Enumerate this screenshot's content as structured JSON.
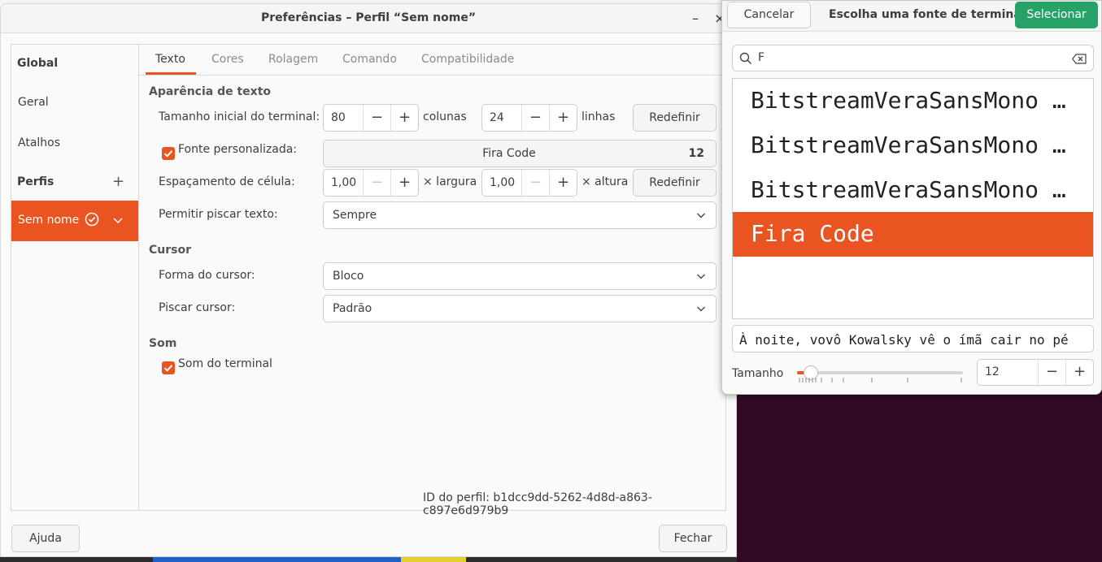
{
  "window": {
    "title": "Preferências – Perfil “Sem nome”",
    "minimize_icon": "–",
    "close_icon": "×"
  },
  "sidebar": {
    "global_header": "Global",
    "items": [
      {
        "label": "Geral"
      },
      {
        "label": "Atalhos"
      }
    ],
    "profiles_header": "Perfis",
    "add_profile_icon": "+",
    "profile": {
      "name": "Sem nome",
      "is_default": true
    }
  },
  "tabs": [
    {
      "label": "Texto",
      "active": true
    },
    {
      "label": "Cores",
      "active": false
    },
    {
      "label": "Rolagem",
      "active": false
    },
    {
      "label": "Comando",
      "active": false
    },
    {
      "label": "Compatibilidade",
      "active": false
    }
  ],
  "text_appearance": {
    "header": "Aparência de texto",
    "initial_size_label": "Tamanho inicial do terminal:",
    "columns_value": "80",
    "columns_unit": "colunas",
    "rows_value": "24",
    "rows_unit": "linhas",
    "reset_label": "Redefinir",
    "custom_font_label": "Fonte personalizada:",
    "custom_font_checked": true,
    "font_name": "Fira Code",
    "font_size": "12",
    "cell_spacing_label": "Espaçamento de célula:",
    "width_value": "1,00",
    "width_unit": "× largura",
    "height_value": "1,00",
    "height_unit": "× altura",
    "reset_label_2": "Redefinir",
    "blink_text_label": "Permitir piscar texto:",
    "blink_text_value": "Sempre",
    "minus": "−",
    "plus": "+"
  },
  "cursor": {
    "header": "Cursor",
    "shape_label": "Forma do cursor:",
    "shape_value": "Bloco",
    "blink_label": "Piscar cursor:",
    "blink_value": "Padrão"
  },
  "sound": {
    "header": "Som",
    "terminal_bell_label": "Som do terminal",
    "terminal_bell_checked": true
  },
  "profile_id": {
    "label": "ID do perfil:",
    "value": "b1dcc9dd-5262-4d8d-a863-c897e6d979b9"
  },
  "footer": {
    "help_label": "Ajuda",
    "close_label": "Fechar"
  },
  "font_dialog": {
    "cancel_label": "Cancelar",
    "title": "Escolha uma fonte de terminal",
    "select_label": "Selecionar",
    "search_value": "F",
    "fonts": [
      {
        "name": "BitstreamVeraSansMono …",
        "selected": false
      },
      {
        "name": "BitstreamVeraSansMono …",
        "selected": false
      },
      {
        "name": "BitstreamVeraSansMono …",
        "selected": false
      },
      {
        "name": "Fira Code",
        "selected": true
      }
    ],
    "preview_text": "À noite, vovô Kowalsky vê o ímã cair no pé",
    "size_label": "Tamanho",
    "size_value": "12",
    "size_slider_fraction": 0.085,
    "minus": "−",
    "plus": "+"
  },
  "colors": {
    "accent": "#e95420",
    "select_button": "#26a269",
    "desktop": "#300a24"
  }
}
